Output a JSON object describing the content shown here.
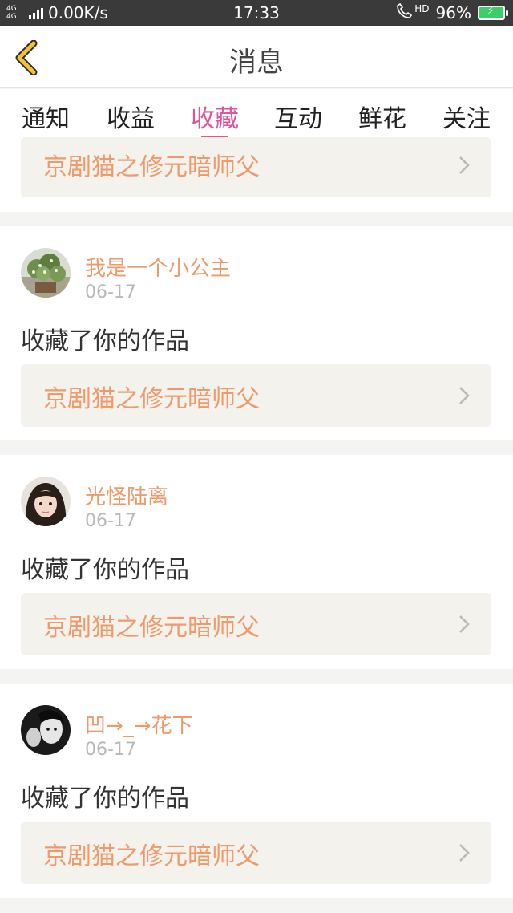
{
  "status_bar": {
    "network_type": "4G 4G",
    "speed": "0.00K/s",
    "time": "17:33",
    "hd_label": "HD",
    "battery": "96%"
  },
  "header": {
    "title": "消息",
    "back_icon": "chevron-left-icon"
  },
  "tabs": [
    {
      "label": "通知",
      "active": false
    },
    {
      "label": "收益",
      "active": false
    },
    {
      "label": "收藏",
      "active": true
    },
    {
      "label": "互动",
      "active": false
    },
    {
      "label": "鲜花",
      "active": false
    },
    {
      "label": "关注",
      "active": false
    }
  ],
  "top_partial": {
    "work_title": "京剧猫之修元暗师父"
  },
  "notifications": [
    {
      "username": "我是一个小公主",
      "date": "06-17",
      "action": "收藏了你的作品",
      "work_title": "京剧猫之修元暗师父",
      "avatar": "plant-photo-avatar"
    },
    {
      "username": "光怪陆离",
      "date": "06-17",
      "action": "收藏了你的作品",
      "work_title": "京剧猫之修元暗师父",
      "avatar": "girl-portrait-avatar"
    },
    {
      "username": "凹→_→花下",
      "date": "06-17",
      "action": "收藏了你的作品",
      "work_title": "京剧猫之修元暗师父",
      "avatar": "dark-portrait-avatar"
    }
  ],
  "colors": {
    "accent": "#e0559a",
    "username": "#f09a6c",
    "work_title": "#f09a6c",
    "back_arrow": "#f2c233"
  }
}
